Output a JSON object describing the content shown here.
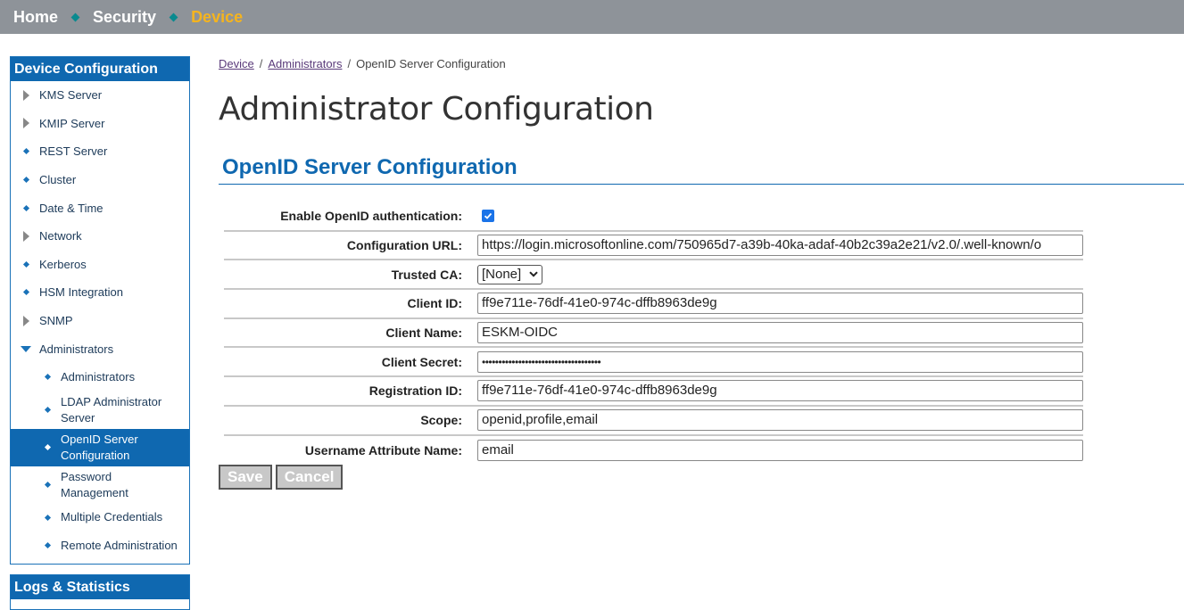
{
  "topnav": {
    "home": "Home",
    "security": "Security",
    "device": "Device"
  },
  "sidebar": {
    "header": "Device Configuration",
    "items": [
      {
        "label": "KMS Server",
        "icon": "triangle-right"
      },
      {
        "label": "KMIP Server",
        "icon": "triangle-right"
      },
      {
        "label": "REST Server",
        "icon": "diamond"
      },
      {
        "label": "Cluster",
        "icon": "diamond"
      },
      {
        "label": "Date & Time",
        "icon": "diamond"
      },
      {
        "label": "Network",
        "icon": "triangle-right"
      },
      {
        "label": "Kerberos",
        "icon": "diamond"
      },
      {
        "label": "HSM Integration",
        "icon": "diamond"
      },
      {
        "label": "SNMP",
        "icon": "triangle-right"
      },
      {
        "label": "Administrators",
        "icon": "triangle-down"
      }
    ],
    "subitems": [
      {
        "label": "Administrators"
      },
      {
        "label": "LDAP Administrator Server"
      },
      {
        "label": "OpenID Server Configuration",
        "selected": true
      },
      {
        "label": "Password Management"
      },
      {
        "label": "Multiple Credentials"
      },
      {
        "label": "Remote Administration"
      }
    ],
    "header2": "Logs & Statistics"
  },
  "breadcrumb": {
    "device": "Device",
    "administrators": "Administrators",
    "current": "OpenID Server Configuration"
  },
  "page_title": "Administrator Configuration",
  "section_title": "OpenID Server Configuration",
  "form": {
    "enable_label": "Enable OpenID authentication:",
    "enable_checked": true,
    "config_url_label": "Configuration URL:",
    "config_url_value": "https://login.microsoftonline.com/750965d7-a39b-40ka-adaf-40b2c39a2e21/v2.0/.well-known/o",
    "trusted_ca_label": "Trusted CA:",
    "trusted_ca_value": "[None]",
    "client_id_label": "Client ID:",
    "client_id_value": "ff9e711e-76df-41e0-974c-dffb8963de9g",
    "client_name_label": "Client Name:",
    "client_name_value": "ESKM-OIDC",
    "client_secret_label": "Client Secret:",
    "client_secret_value": "••••••••••••••••••••••••••••••••••••",
    "registration_id_label": "Registration ID:",
    "registration_id_value": "ff9e711e-76df-41e0-974c-dffb8963de9g",
    "scope_label": "Scope:",
    "scope_value": "openid,profile,email",
    "username_attr_label": "Username Attribute Name:",
    "username_attr_value": "email"
  },
  "buttons": {
    "save": "Save",
    "cancel": "Cancel"
  },
  "colors": {
    "nav_bg": "#8e9399",
    "accent": "#0f68b0",
    "active_nav": "#f5b41e"
  }
}
